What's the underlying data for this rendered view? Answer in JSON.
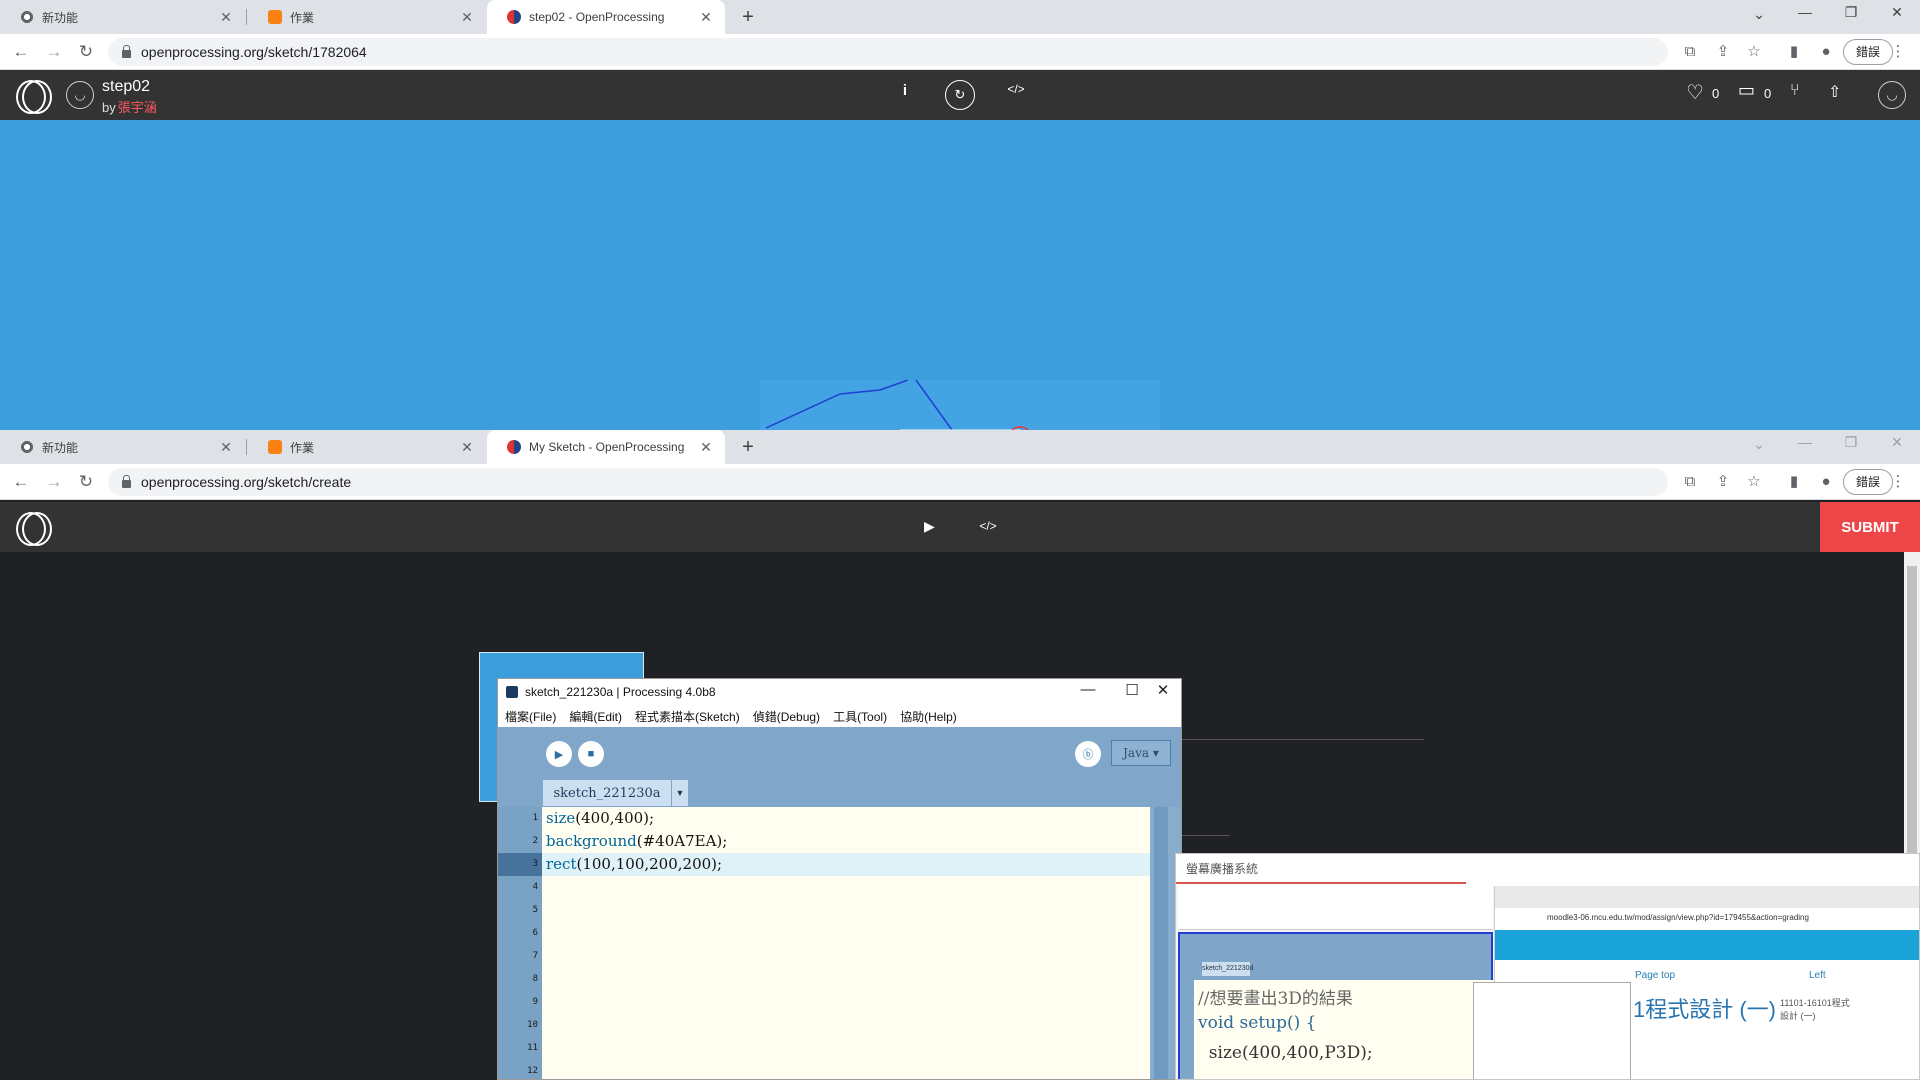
{
  "browser_top": {
    "tabs": [
      {
        "title": "新功能",
        "active": false
      },
      {
        "title": "作業",
        "active": false
      },
      {
        "title": "step02 - OpenProcessing",
        "active": true
      }
    ],
    "url": "openprocessing.org/sketch/1782064",
    "profile_label": "錯誤"
  },
  "sketch_header": {
    "title": "step02",
    "by": "by",
    "author": "張宇涵",
    "likes": "0",
    "comments": "0"
  },
  "browser_bottom": {
    "tabs": [
      {
        "title": "新功能",
        "active": false
      },
      {
        "title": "作業",
        "active": false
      },
      {
        "title": "My Sketch - OpenProcessing",
        "active": true
      }
    ],
    "url": "openprocessing.org/sketch/create",
    "profile_label": "錯誤"
  },
  "create_header": {
    "submit_label": "SUBMIT"
  },
  "processing_ide": {
    "window_title": "sketch_221230a | Processing 4.0b8",
    "menus": [
      "檔案(File)",
      "編輯(Edit)",
      "程式素描本(Sketch)",
      "偵錯(Debug)",
      "工具(Tool)",
      "協助(Help)"
    ],
    "mode": "Java ▾",
    "tab_name": "sketch_221230a",
    "code_lines": [
      {
        "fn": "size",
        "args": "(400,400);"
      },
      {
        "fn": "background",
        "args": "(#40A7EA);"
      },
      {
        "fn": "rect",
        "args": "(100,100,200,200);"
      }
    ],
    "line_numbers": [
      "1",
      "2",
      "3",
      "4",
      "5",
      "6",
      "7",
      "8",
      "9",
      "10",
      "11",
      "12"
    ],
    "highlighted_line": 3
  },
  "broadcast_window": {
    "title": "螢幕廣播系統",
    "inner_url": "moodle3-06.mcu.edu.tw/mod/assign/view.php?id=179455&action=grading",
    "inner_tab": "sketch_221230d",
    "inner_code": [
      "//想要畫出3D的結果",
      "void setup() {",
      "  size(400,400,P3D);"
    ],
    "page_top_label": "Page top",
    "left_label": "Left",
    "course_title": "1程式設計 (一)",
    "course_code": "11101-16101程式設計 (一)"
  },
  "colors": {
    "sketch_background": "#40A7EA",
    "submit": "#ED4648",
    "author": "#FF5A5F"
  }
}
